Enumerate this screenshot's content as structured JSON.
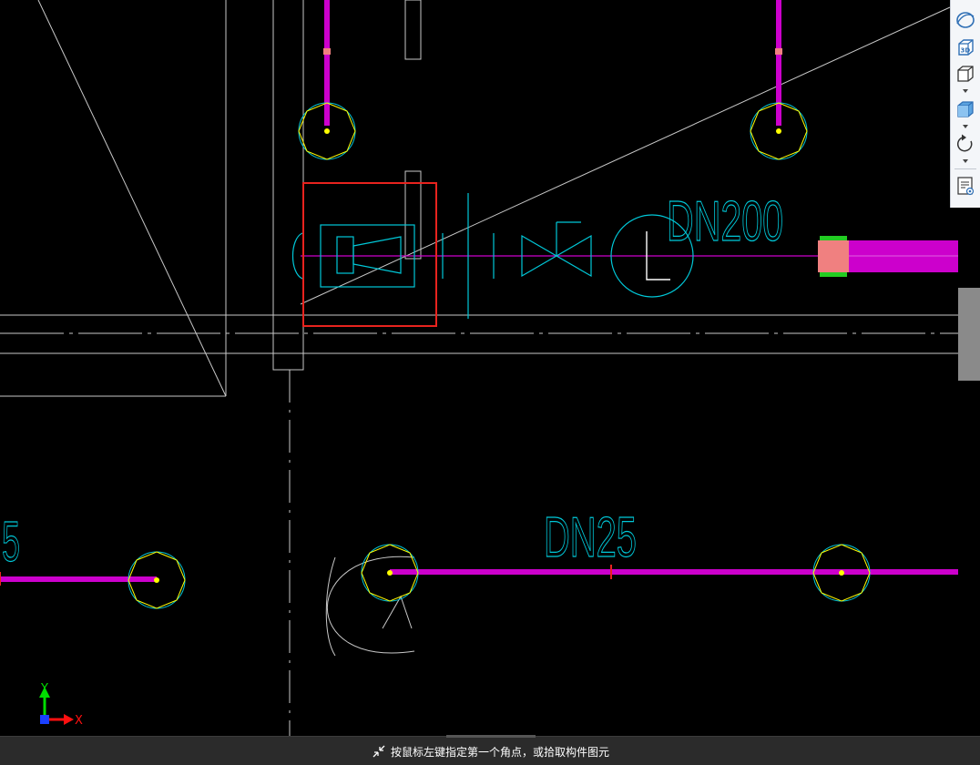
{
  "drawing": {
    "pipe_labels": {
      "dn200": "DN200",
      "dn25": "DN25",
      "left_partial": "5"
    },
    "axis": {
      "x_label": "X",
      "y_label": "Y"
    },
    "colors": {
      "background": "#000000",
      "pipe": "#cc00cc",
      "symbol": "#00c8d8",
      "wall": "#c8c8c8",
      "highlight": "#e8231e",
      "node": "#ffff00",
      "fitting": "#f08080",
      "flange": "#22cc22"
    }
  },
  "toolbar": {
    "items": [
      "orbit-icon",
      "3d-view-icon",
      "cube-wire-icon",
      "cube-solid-icon",
      "rotate-icon",
      "properties-icon"
    ]
  },
  "status": {
    "prompt": "按鼠标左键指定第一个角点，或拾取构件图元"
  }
}
